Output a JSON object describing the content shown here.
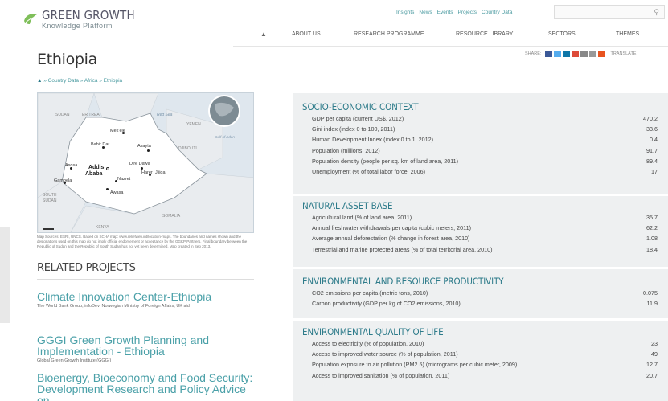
{
  "header": {
    "logo_title": "GREEN GROWTH",
    "logo_sub": "Knowledge Platform",
    "toplinks": [
      "Insights",
      "News",
      "Events",
      "Projects",
      "Country Data"
    ],
    "nav": [
      "ABOUT US",
      "RESEARCH PROGRAMME",
      "RESOURCE LIBRARY",
      "SECTORS",
      "THEMES"
    ]
  },
  "page": {
    "title": "Ethiopia",
    "share_label": "SHARE:",
    "translate_label": "TRANSLATE",
    "breadcrumb": "» Country Data » Africa » Ethiopia"
  },
  "map": {
    "labels": [
      "SUDAN",
      "ERITREA",
      "Red Sea",
      "YEMEN",
      "Mek'ele",
      "Gulf of Aden",
      "Bahir Dar",
      "Asayta",
      "DJIBOUTI",
      "Dire Dawa",
      "Asosa",
      "Addis",
      "Ababa",
      "Harer",
      "Jijiga",
      "Gambela",
      "Nazret",
      "Awasa",
      "SOUTH",
      "SUDAN",
      "SOMALIA",
      "KENYA"
    ],
    "note": "Map Sources: ESRI, UNCS. Based on SCHA map: www.reliefweb.int/location-maps. The boundaries and names shown and the designations used on this map do not imply official endorsement or acceptance by the GGKP Partners. Final boundary between the Republic of Sudan and the Republic of South Sudan has not yet been determined. Map created in Sep 2013."
  },
  "related": {
    "title": "RELATED PROJECTS",
    "items": [
      {
        "name": "Climate Innovation Center-Ethiopia",
        "org": "The World Bank Group, infoDev, Norwegian Ministry of Foreign Affairs, UK aid"
      },
      {
        "name": "GGGI Green Growth Planning and Implementation - Ethiopia",
        "org": "Global Green Growth Institute (GGGI)"
      },
      {
        "name": "Bioenergy, Bioeconomy and Food Security: Development Research and Policy Advice on",
        "org": ""
      }
    ]
  },
  "sections": [
    {
      "title": "SOCIO-ECONOMIC CONTEXT",
      "rows": [
        {
          "label": "GDP per capita (current US$, 2012)",
          "value": "470.2"
        },
        {
          "label": "Gini index (index 0 to 100, 2011)",
          "value": "33.6"
        },
        {
          "label": "Human Development Index (index 0 to 1, 2012)",
          "value": "0.4"
        },
        {
          "label": "Population (millions, 2012)",
          "value": "91.7"
        },
        {
          "label": "Population density (people per sq. km of land area, 2011)",
          "value": "89.4"
        },
        {
          "label": "Unemployment (% of total labor force, 2006)",
          "value": "17"
        }
      ]
    },
    {
      "title": "NATURAL ASSET BASE",
      "rows": [
        {
          "label": "Agricultural land (% of land area, 2011)",
          "value": "35.7"
        },
        {
          "label": "Annual freshwater withdrawals per capita (cubic meters, 2011)",
          "value": "62.2"
        },
        {
          "label": "Average annual deforestation (% change in forest area, 2010)",
          "value": "1.08"
        },
        {
          "label": "Terrestrial and marine protected areas (% of total territorial area, 2010)",
          "value": "18.4"
        }
      ]
    },
    {
      "title": "ENVIRONMENTAL AND RESOURCE PRODUCTIVITY",
      "rows": [
        {
          "label": "CO2 emissions per capita (metric tons, 2010)",
          "value": "0.075"
        },
        {
          "label": "Carbon productivity (GDP per kg of CO2 emissions, 2010)",
          "value": "11.9"
        }
      ]
    },
    {
      "title": "ENVIRONMENTAL QUALITY OF LIFE",
      "rows": [
        {
          "label": "Access to electricity (% of population, 2010)",
          "value": "23"
        },
        {
          "label": "Access to improved water source (% of population, 2011)",
          "value": "49"
        },
        {
          "label": "Population exposure to air pollution (PM2.5) (micrograms per cubic meter, 2009)",
          "value": "12.7"
        },
        {
          "label": "Access to improved sanitation (% of population, 2011)",
          "value": "20.7"
        }
      ]
    }
  ],
  "colors": {
    "accent": "#4aa0a8",
    "section_title": "#2d7b8a",
    "panel_bg": "#eef0f1"
  }
}
